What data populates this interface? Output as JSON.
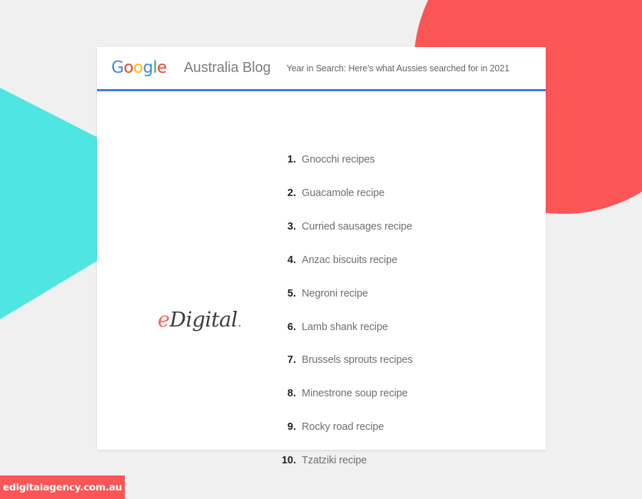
{
  "colors": {
    "background": "#f0f0f0",
    "card": "#ffffff",
    "accent_red": "#fb5555",
    "accent_teal": "#4fe5e3",
    "rule_blue": "#3b78e7",
    "google_blue": "#4285f4",
    "google_red": "#ea4335",
    "google_yellow": "#fbbc05",
    "google_green": "#34a853",
    "rank_text": "#202124",
    "item_text": "#6c6f73",
    "blog_title_text": "#7a7c80",
    "subtitle_text": "#5f6368"
  },
  "header": {
    "logo": {
      "full_text": "Google",
      "letters": [
        {
          "char": "G",
          "color_name": "blue"
        },
        {
          "char": "o",
          "color_name": "red"
        },
        {
          "char": "o",
          "color_name": "yellow"
        },
        {
          "char": "g",
          "color_name": "blue"
        },
        {
          "char": "l",
          "color_name": "green"
        },
        {
          "char": "e",
          "color_name": "red"
        }
      ]
    },
    "blog_title": "Australia Blog",
    "subtitle": "Year in Search: Here's what Aussies searched for in 2021"
  },
  "watermark": {
    "e": "e",
    "digital": "Digital",
    "dot": "."
  },
  "list": {
    "items": [
      {
        "rank": "1.",
        "label": "Gnocchi recipes"
      },
      {
        "rank": "2.",
        "label": "Guacamole recipe"
      },
      {
        "rank": "3.",
        "label": "Curried sausages recipe"
      },
      {
        "rank": "4.",
        "label": "Anzac biscuits recipe"
      },
      {
        "rank": "5.",
        "label": "Negroni recipe"
      },
      {
        "rank": "6.",
        "label": "Lamb shank recipe"
      },
      {
        "rank": "7.",
        "label": "Brussels sprouts recipes"
      },
      {
        "rank": "8.",
        "label": "Minestrone soup recipe"
      },
      {
        "rank": "9.",
        "label": "Rocky road recipe"
      },
      {
        "rank": "10.",
        "label": "Tzatziki recipe"
      }
    ]
  },
  "badge": {
    "url": "edigitalagency.com.au"
  }
}
